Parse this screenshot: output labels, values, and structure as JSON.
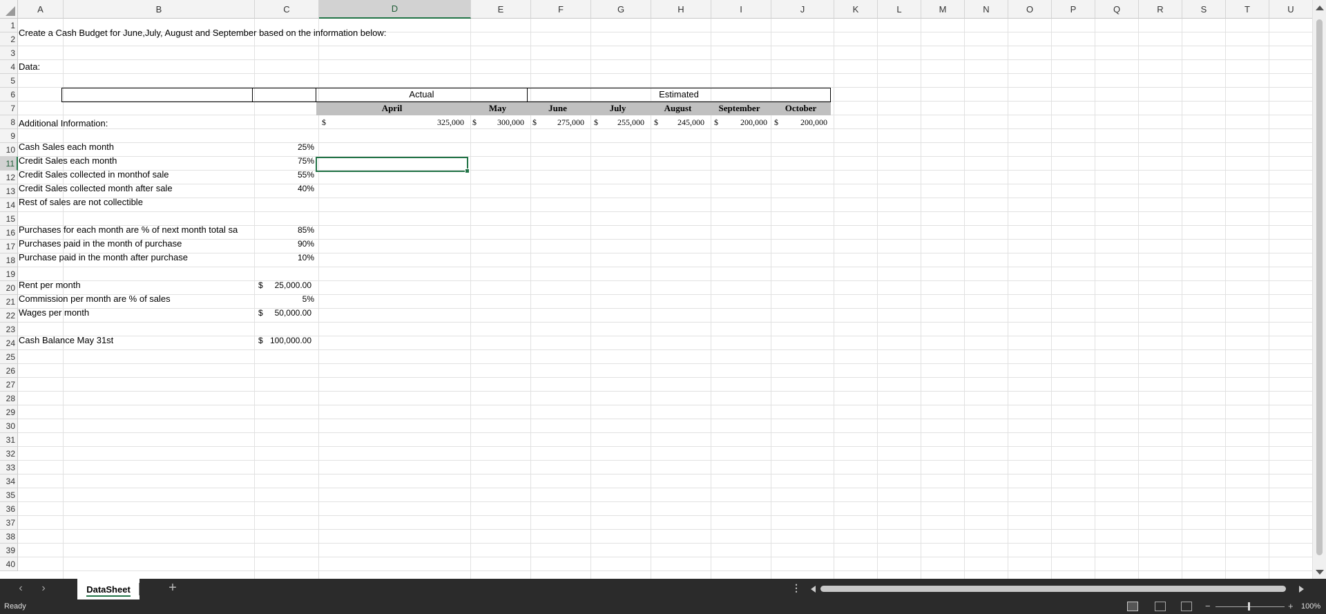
{
  "columns": [
    "A",
    "B",
    "C",
    "D",
    "E",
    "F",
    "G",
    "H",
    "I",
    "J",
    "K",
    "L",
    "M",
    "N",
    "O",
    "P",
    "Q",
    "R",
    "S",
    "T",
    "U"
  ],
  "selected_column": "D",
  "rows": [
    "1",
    "2",
    "3",
    "4",
    "5",
    "6",
    "7",
    "8",
    "9",
    "10",
    "11",
    "12",
    "13",
    "14",
    "15",
    "16",
    "17",
    "18",
    "19",
    "20",
    "21",
    "22",
    "23",
    "24",
    "25",
    "26",
    "27",
    "28",
    "29",
    "30",
    "31",
    "32",
    "33",
    "34",
    "35",
    "36",
    "37",
    "38",
    "39",
    "40"
  ],
  "selected_row": "11",
  "cells": {
    "B2": "Create a Cash Budget for June,July, August and September based on the information below:",
    "B5": "Data:",
    "actual_label": "Actual",
    "estimated_label": "Estimated",
    "months": [
      "April",
      "May",
      "June",
      "July",
      "August",
      "September",
      "October"
    ],
    "currency_symbol": "$",
    "sales_values": [
      "325,000",
      "300,000",
      "275,000",
      "255,000",
      "245,000",
      "200,000",
      "200,000"
    ],
    "B10": "Additional Information:",
    "B12": "Cash Sales each month",
    "C12": "25%",
    "B13": "Credit Sales each month",
    "C13": "75%",
    "B14": "Credit Sales collected  in monthof sale",
    "C14": "55%",
    "B15": "Credit Sales collected month after sale",
    "C15": "40%",
    "B16": "Rest of sales are not collectible",
    "B18": "Purchases for each month  are % of next month total sa",
    "C18": "85%",
    "B19": "Purchases paid in the month of purchase",
    "C19": "90%",
    "B20": "Purchase paid in the month after purchase",
    "C20": "10%",
    "B22": "Rent per month",
    "C22_symbol": "$",
    "C22": "25,000.00",
    "B23": "Commission per month are % of sales",
    "C23": "5%",
    "B24": "Wages per month",
    "C24_symbol": "$",
    "C24": "50,000.00",
    "B26": "Cash Balance May 31st",
    "C26_symbol": "$",
    "C26": "100,000.00"
  },
  "tabs": {
    "sheet_name": "DataSheet",
    "add_sheet": "+",
    "more": "⋮",
    "prev": "‹",
    "next": "›"
  },
  "status": {
    "text": "Ready",
    "zoom_level": "100%",
    "zoom_minus": "−",
    "zoom_plus": "+"
  }
}
